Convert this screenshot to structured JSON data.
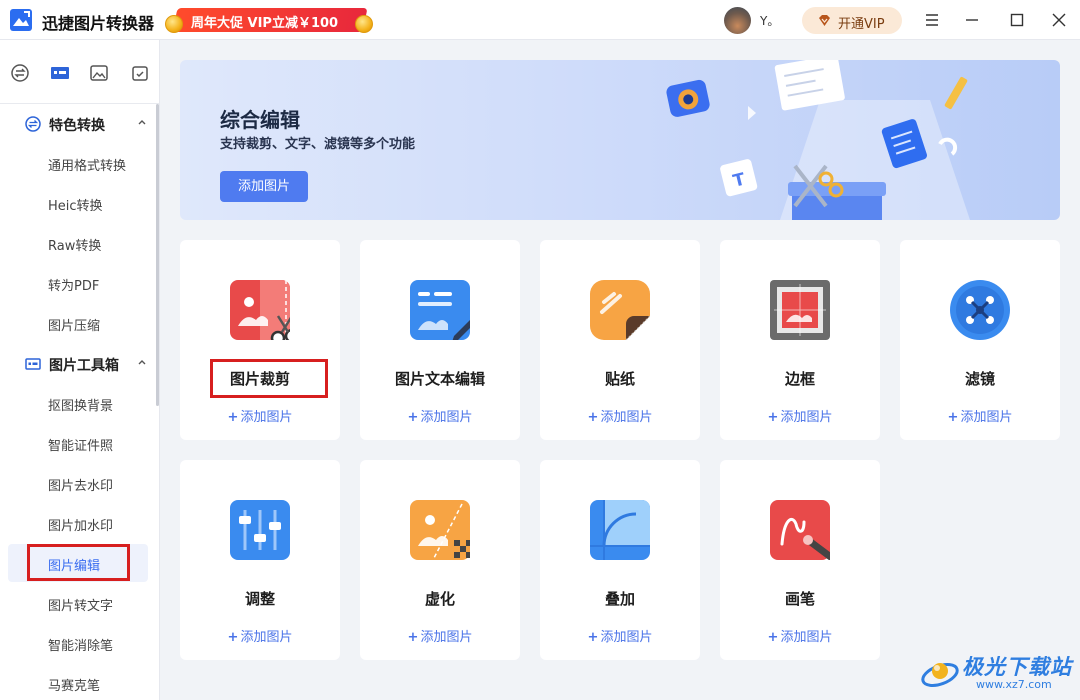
{
  "app": {
    "title": "迅捷图片转换器"
  },
  "promo": {
    "text": "周年大促 VIP立减￥100"
  },
  "user": {
    "name": "Y。"
  },
  "vip": {
    "label": "开通VIP"
  },
  "sidebar": {
    "sections": [
      {
        "label": "特色转换",
        "items": [
          "通用格式转换",
          "Heic转换",
          "Raw转换",
          "转为PDF",
          "图片压缩"
        ]
      },
      {
        "label": "图片工具箱",
        "items": [
          "抠图换背景",
          "智能证件照",
          "图片去水印",
          "图片加水印",
          "图片编辑",
          "图片转文字",
          "智能消除笔",
          "马赛克笔"
        ]
      }
    ],
    "active_item": "图片编辑"
  },
  "banner": {
    "title": "综合编辑",
    "subtitle": "支持裁剪、文字、滤镜等多个功能",
    "button": "添加图片"
  },
  "tools": [
    {
      "title": "图片裁剪",
      "add": "添加图片",
      "icon": "crop-icon"
    },
    {
      "title": "图片文本编辑",
      "add": "添加图片",
      "icon": "text-edit-icon"
    },
    {
      "title": "贴纸",
      "add": "添加图片",
      "icon": "sticker-icon"
    },
    {
      "title": "边框",
      "add": "添加图片",
      "icon": "border-icon"
    },
    {
      "title": "滤镜",
      "add": "添加图片",
      "icon": "filter-icon"
    },
    {
      "title": "调整",
      "add": "添加图片",
      "icon": "adjust-icon"
    },
    {
      "title": "虚化",
      "add": "添加图片",
      "icon": "blur-icon"
    },
    {
      "title": "叠加",
      "add": "添加图片",
      "icon": "overlay-icon"
    },
    {
      "title": "画笔",
      "add": "添加图片",
      "icon": "brush-icon"
    }
  ],
  "watermark": {
    "text": "极光下载站",
    "url": "www.xz7.com"
  },
  "colors": {
    "accent": "#4f7bf0",
    "highlight": "#d71f1f",
    "link": "#4a73e8"
  }
}
